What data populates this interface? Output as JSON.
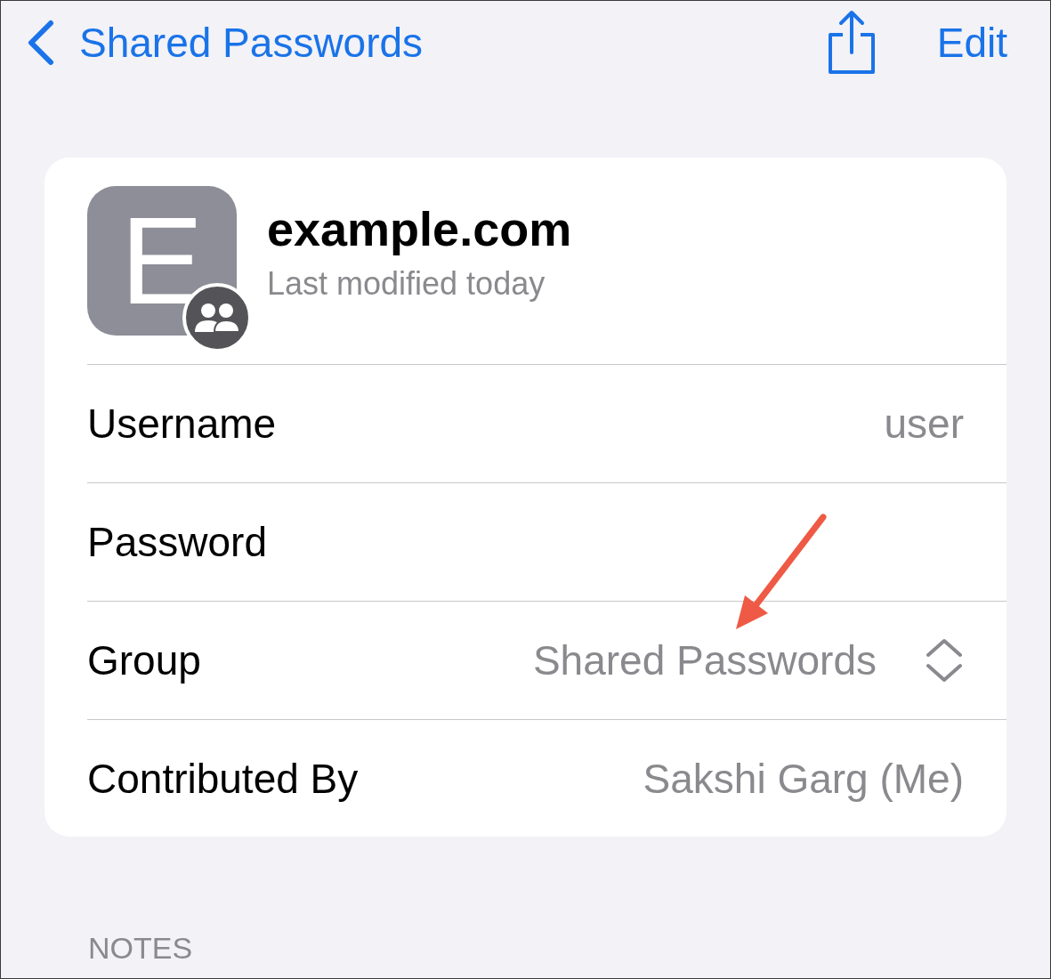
{
  "nav": {
    "back_label": "Shared Passwords",
    "edit_label": "Edit"
  },
  "entry": {
    "letter": "E",
    "shared": true,
    "title": "example.com",
    "subtitle": "Last modified today"
  },
  "rows": [
    {
      "kind": "text",
      "label": "Username",
      "value": "user"
    },
    {
      "kind": "text",
      "label": "Password"
    },
    {
      "kind": "picker",
      "label": "Group",
      "value": "Shared Passwords"
    },
    {
      "kind": "text",
      "label": "Contributed By",
      "value": "Sakshi Garg (Me)"
    }
  ],
  "notes_header": "NOTES"
}
